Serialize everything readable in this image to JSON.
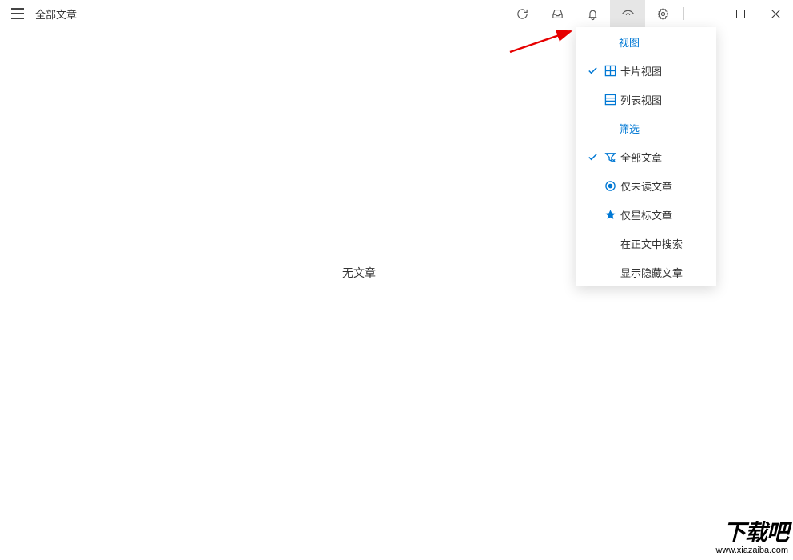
{
  "header": {
    "title": "全部文章"
  },
  "main": {
    "empty_text": "无文章"
  },
  "dropdown": {
    "section_view": "视图",
    "card_view": "卡片视图",
    "list_view": "列表视图",
    "section_filter": "筛选",
    "all_articles": "全部文章",
    "unread_only": "仅未读文章",
    "starred_only": "仅星标文章",
    "search_in_body": "在正文中搜索",
    "show_hidden": "显示隐藏文章"
  },
  "watermark": {
    "text": "下载吧",
    "url": "www.xiazaiba.com"
  },
  "colors": {
    "accent": "#0078d4"
  }
}
